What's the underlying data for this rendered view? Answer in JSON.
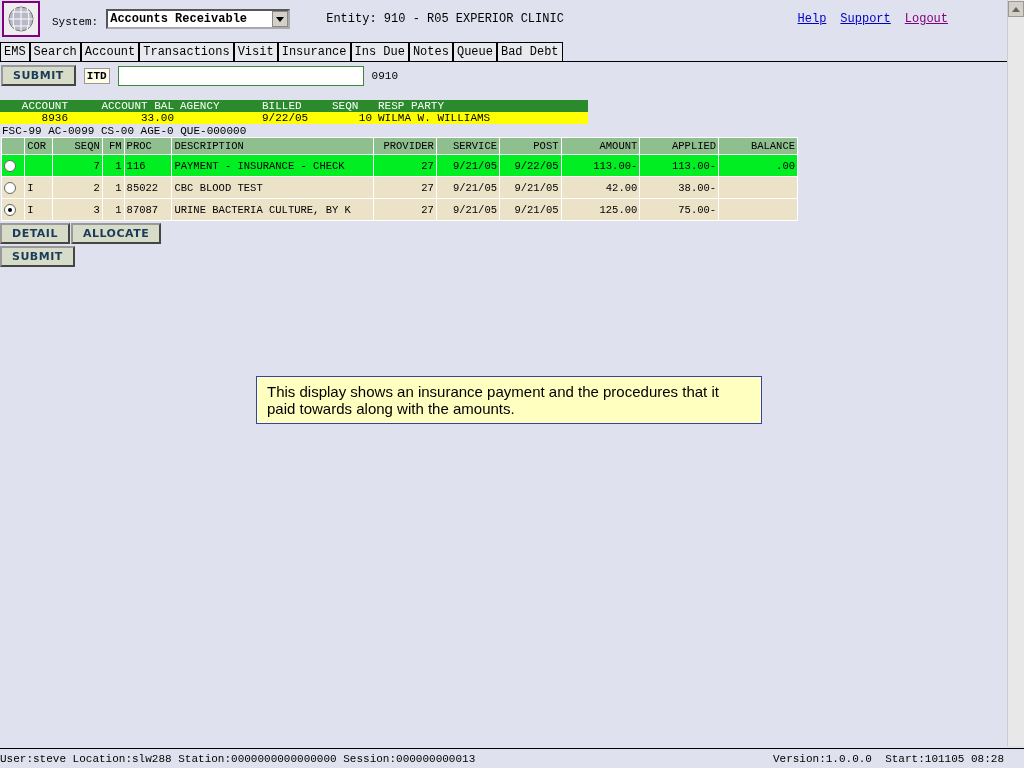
{
  "header": {
    "system_label": "System:",
    "system_value": "Accounts Receivable",
    "entity": "Entity: 910 - R05 EXPERIOR CLINIC",
    "links": [
      {
        "label": "Help",
        "visited": false
      },
      {
        "label": "Support",
        "visited": false
      },
      {
        "label": "Logout",
        "visited": true
      }
    ]
  },
  "tabs": [
    {
      "label": "EMS"
    },
    {
      "label": "Search"
    },
    {
      "label": "Account"
    },
    {
      "label": "Transactions"
    },
    {
      "label": "Visit"
    },
    {
      "label": "Insurance"
    },
    {
      "label": "Ins Due"
    },
    {
      "label": "Notes"
    },
    {
      "label": "Queue"
    },
    {
      "label": "Bad Debt"
    }
  ],
  "command": {
    "submit": "SUBMIT",
    "code": "ITD",
    "entity_code": "0910"
  },
  "account": {
    "fields": [
      {
        "label": "ACCOUNT",
        "value": "8936"
      },
      {
        "label": "ACCOUNT BAL",
        "value": "33.00"
      },
      {
        "label": "AGENCY"
      },
      {
        "label": "BILLED",
        "value": "9/22/05"
      },
      {
        "label": "SEQN",
        "value": "10"
      },
      {
        "label": "RESP PARTY",
        "value": "WILMA W. WILLIAMS"
      }
    ],
    "codes": "FSC-99 AC-0099 CS-00 AGE-0 QUE-000000"
  },
  "table": {
    "columns": [
      "COR",
      "SEQN",
      "FM",
      "PROC",
      "DESCRIPTION",
      "PROVIDER",
      "SERVICE",
      "POST",
      "AMOUNT",
      "APPLIED",
      "BALANCE"
    ],
    "rows": [
      {
        "selected": false,
        "highlighted": true,
        "cells": [
          null,
          "7",
          "1",
          "116",
          "PAYMENT - INSURANCE - CHECK",
          "27",
          "9/21/05",
          "9/22/05",
          "113.00-",
          "113.00-",
          ".00"
        ]
      },
      {
        "selected": false,
        "highlighted": false,
        "cells": [
          "I",
          "2",
          "1",
          "85022",
          "CBC BLOOD TEST",
          "27",
          "9/21/05",
          "9/21/05",
          "42.00",
          "38.00-",
          null
        ]
      },
      {
        "selected": true,
        "highlighted": false,
        "cells": [
          "I",
          "3",
          "1",
          "87087",
          "URINE BACTERIA CULTURE, BY K",
          "27",
          "9/21/05",
          "9/21/05",
          "125.00",
          "75.00-",
          null
        ]
      }
    ]
  },
  "actions": [
    "DETAIL",
    "ALLOCATE"
  ],
  "bottom_submit": "SUBMIT",
  "note": "This display shows an insurance payment and the procedures that it paid towards along with the amounts.",
  "status_bar": {
    "left": "User:steve Location:slw288 Station:0000000000000000 Session:000000000013",
    "right": "Version:1.0.0.0  Start:101105 08:28"
  }
}
